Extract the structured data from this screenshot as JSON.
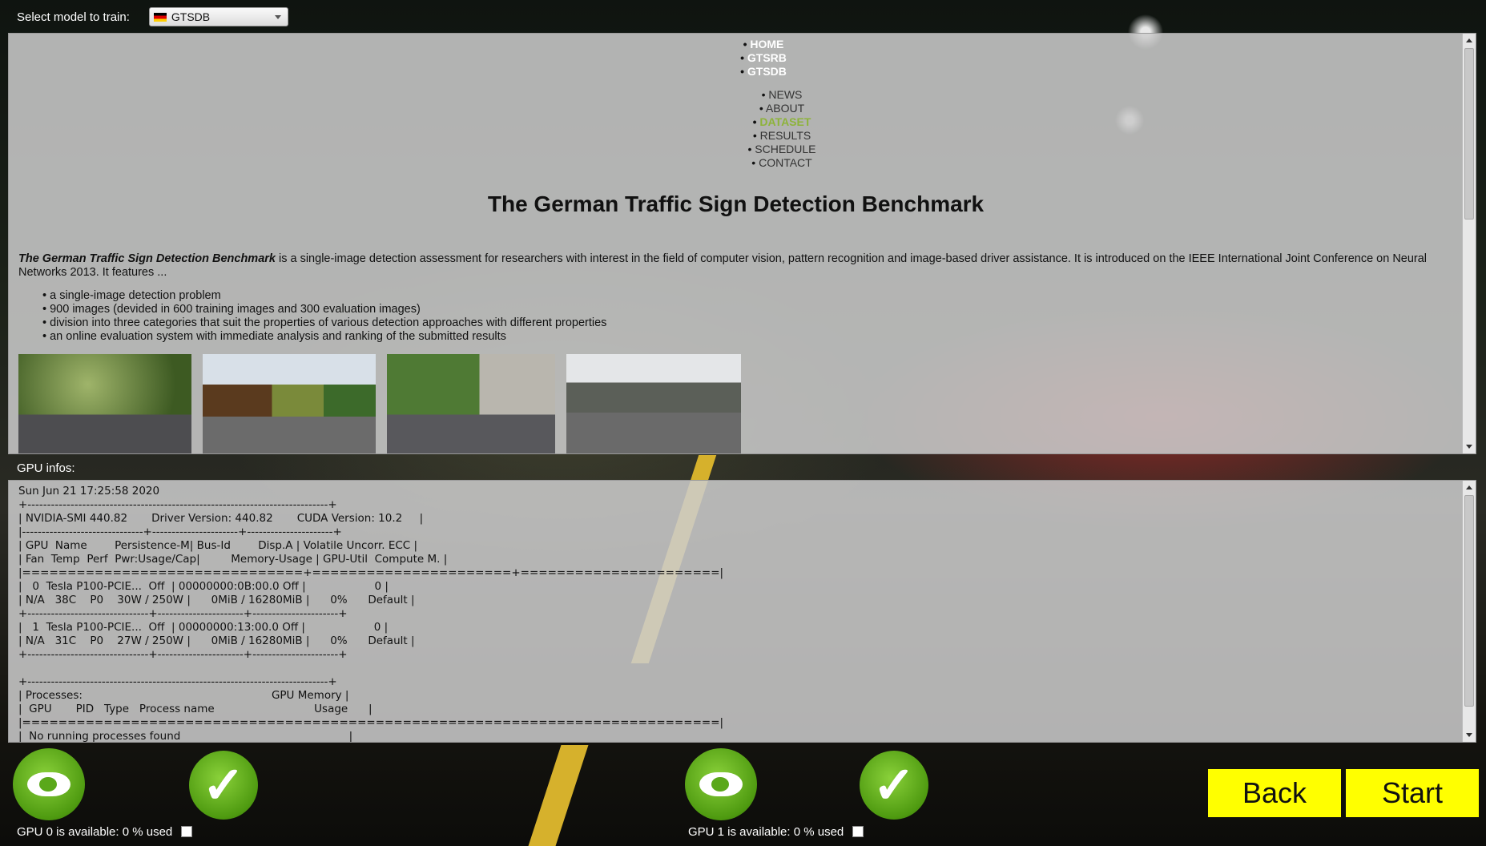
{
  "header": {
    "select_label": "Select model to train:",
    "selected_model": "GTSDB"
  },
  "web": {
    "nav_primary": [
      "HOME",
      "GTSRB",
      "GTSDB"
    ],
    "nav_secondary": [
      "NEWS",
      "ABOUT",
      "DATASET",
      "RESULTS",
      "SCHEDULE",
      "CONTACT"
    ],
    "active_item": "DATASET",
    "title": "The German Traffic Sign Detection Benchmark",
    "intro_em": "The German Traffic Sign Detection Benchmark",
    "intro_rest": " is a single-image detection assessment for researchers with interest in the field of computer vision, pattern recognition and image-based driver assistance. It is introduced on the IEEE International Joint Conference on Neural Networks 2013. It features ...",
    "features": [
      "a single-image detection problem",
      "900 images (devided in 600 training images and 300 evaluation images)",
      "division into three categories that suit the properties of various detection approaches with different properties",
      "an online evaluation system with immediate analysis and ranking of the submitted results"
    ]
  },
  "gpu_label": "GPU infos:",
  "gpu_lines": [
    "Sun Jun 21 17:25:58 2020",
    "+-----------------------------------------------------------------------------+",
    "| NVIDIA-SMI 440.82       Driver Version: 440.82       CUDA Version: 10.2     |",
    "|-------------------------------+----------------------+----------------------+",
    "| GPU  Name        Persistence-M| Bus-Id        Disp.A | Volatile Uncorr. ECC |",
    "| Fan  Temp  Perf  Pwr:Usage/Cap|         Memory-Usage | GPU-Util  Compute M. |",
    "|===============================+======================+======================|",
    "|   0  Tesla P100-PCIE...  Off  | 00000000:0B:00.0 Off |                    0 |",
    "| N/A   38C    P0    30W / 250W |      0MiB / 16280MiB |      0%      Default |",
    "+-------------------------------+----------------------+----------------------+",
    "|   1  Tesla P100-PCIE...  Off  | 00000000:13:00.0 Off |                    0 |",
    "| N/A   31C    P0    27W / 250W |      0MiB / 16280MiB |      0%      Default |",
    "+-------------------------------+----------------------+----------------------+",
    "",
    "+-----------------------------------------------------------------------------+",
    "| Processes:                                                       GPU Memory |",
    "|  GPU       PID   Type   Process name                             Usage      |",
    "|=============================================================================|",
    "|  No running processes found                                                 |"
  ],
  "gpu0_status": "GPU 0 is available: 0 % used",
  "gpu1_status": "GPU 1 is available: 0 % used",
  "buttons": {
    "back": "Back",
    "start": "Start"
  },
  "icons": {
    "gpu": "nvidia-logo-icon",
    "ok": "checkmark-icon"
  },
  "colors": {
    "accent_button": "#ffff00",
    "nav_active": "#8db33a",
    "icon_green": "#5aa81a"
  }
}
